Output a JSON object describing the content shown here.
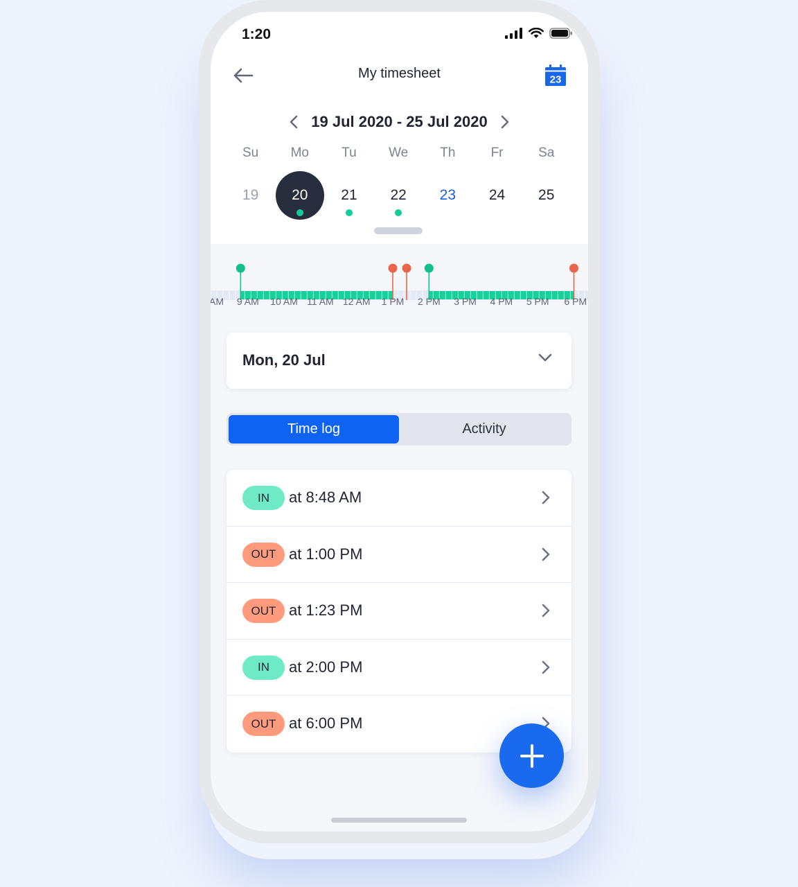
{
  "status_bar": {
    "time": "1:20"
  },
  "header": {
    "title": "My timesheet",
    "calendar_day": "23"
  },
  "week": {
    "label": "19 Jul 2020 - 25 Jul 2020",
    "weekdays": [
      "Su",
      "Mo",
      "Tu",
      "We",
      "Th",
      "Fr",
      "Sa"
    ],
    "dates": [
      {
        "num": "19",
        "state": "muted",
        "has_entry": false
      },
      {
        "num": "20",
        "state": "selected",
        "has_entry": true
      },
      {
        "num": "21",
        "state": "normal",
        "has_entry": true
      },
      {
        "num": "22",
        "state": "normal",
        "has_entry": true
      },
      {
        "num": "23",
        "state": "today",
        "has_entry": false
      },
      {
        "num": "24",
        "state": "normal",
        "has_entry": false
      },
      {
        "num": "25",
        "state": "normal",
        "has_entry": false
      }
    ]
  },
  "timeline": {
    "hour_labels": [
      "AM",
      "9 AM",
      "10 AM",
      "11 AM",
      "12 AM",
      "1 PM",
      "2 PM",
      "3 PM",
      "4 PM",
      "5 PM",
      "6 PM"
    ],
    "colors": {
      "worked": "#16d19a",
      "in_marker": "#12c08f",
      "out_marker": "#e9664a",
      "empty": "#e4e9f6"
    }
  },
  "day_selector": {
    "label": "Mon, 20 Jul"
  },
  "tabs": [
    {
      "label": "Time log",
      "active": true
    },
    {
      "label": "Activity",
      "active": false
    }
  ],
  "time_log": [
    {
      "type": "in",
      "badge": "IN",
      "text": "at 8:48 AM"
    },
    {
      "type": "out",
      "badge": "OUT",
      "text": "at 1:00 PM"
    },
    {
      "type": "out",
      "badge": "OUT",
      "text": "at 1:23 PM"
    },
    {
      "type": "in",
      "badge": "IN",
      "text": "at 2:00 PM"
    },
    {
      "type": "out",
      "badge": "OUT",
      "text": "at 6:00 PM"
    }
  ],
  "colors": {
    "accent": "#0f63f2",
    "in_badge": "#6eeac6",
    "out_badge": "#ff9b7c",
    "selected_day": "#262d3d"
  }
}
